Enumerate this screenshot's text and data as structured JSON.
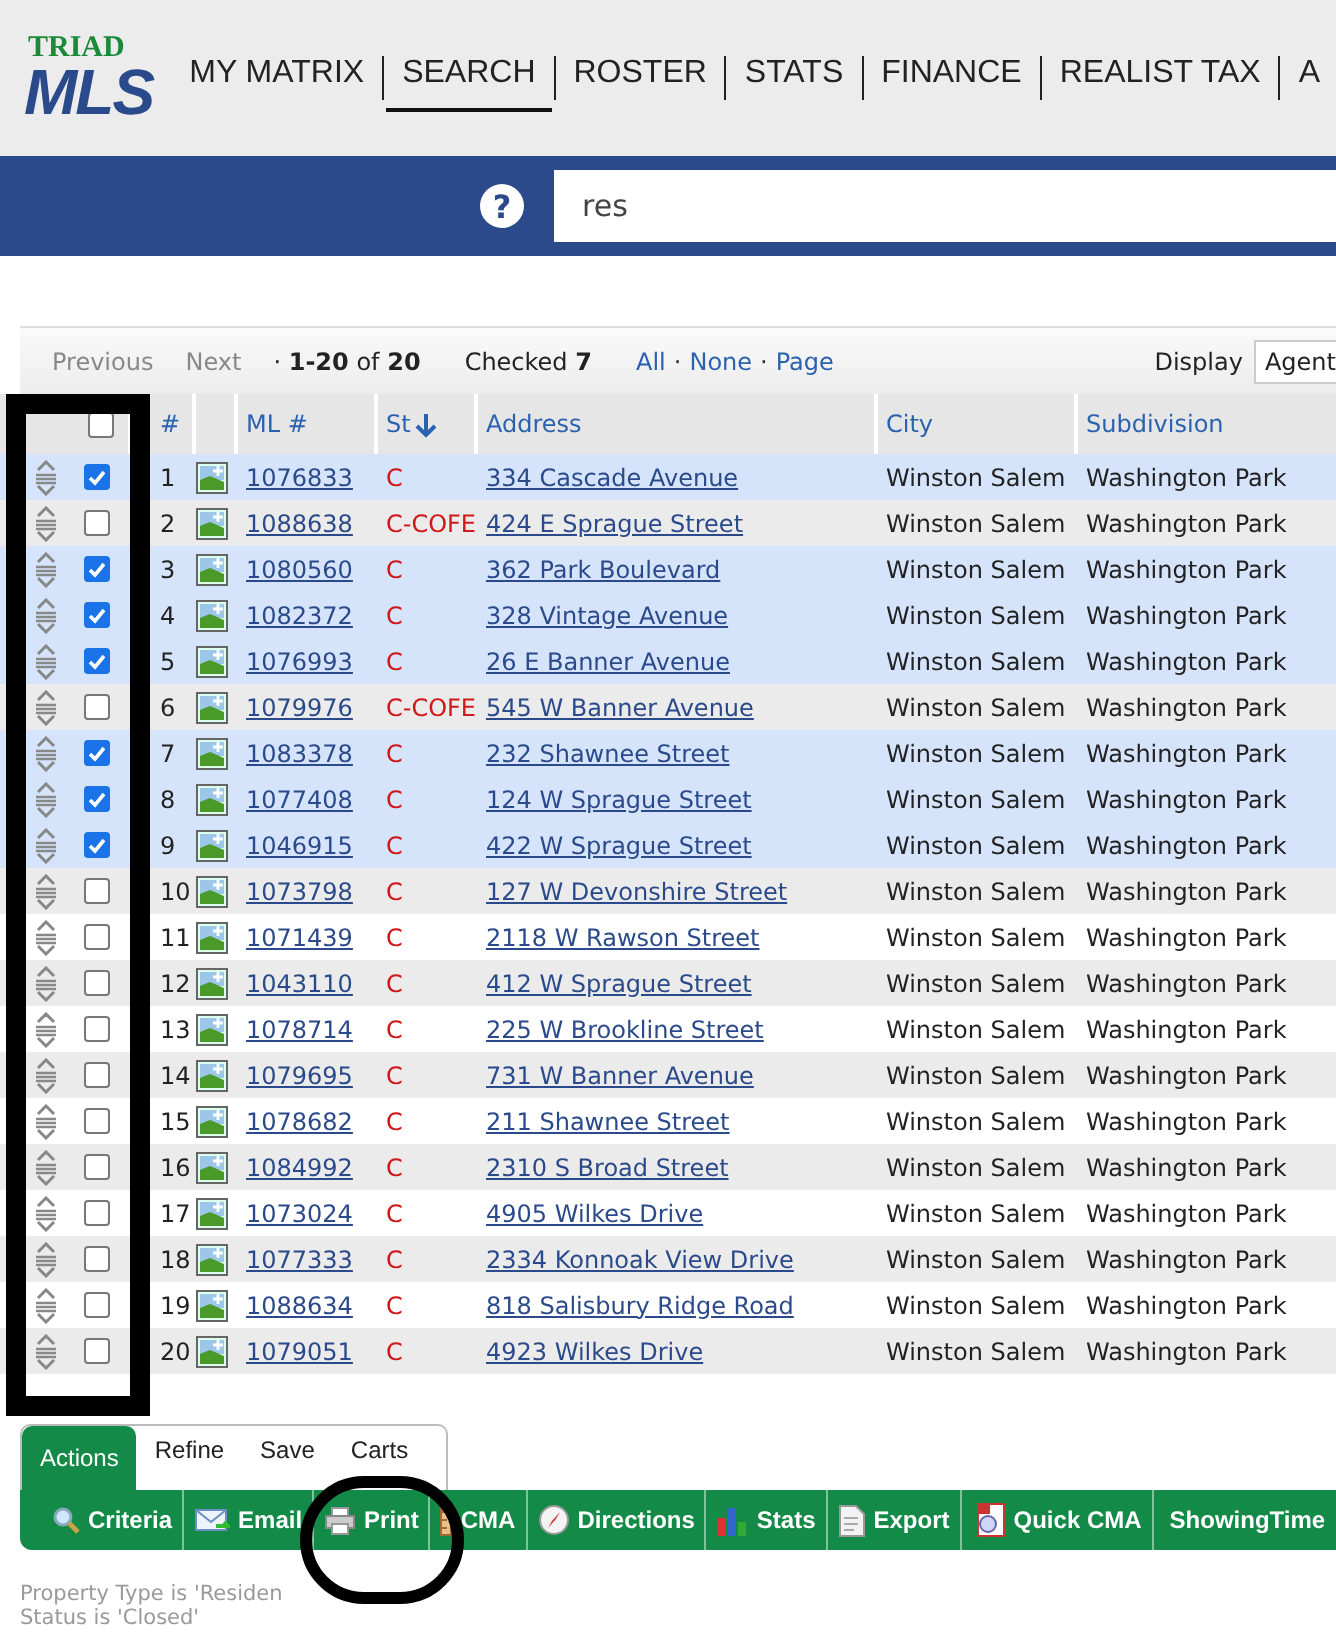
{
  "logo": {
    "top": "TRIAD",
    "main": "MLS"
  },
  "nav": [
    {
      "label": "MY MATRIX",
      "selected": false
    },
    {
      "label": "SEARCH",
      "selected": true
    },
    {
      "label": "ROSTER",
      "selected": false
    },
    {
      "label": "STATS",
      "selected": false
    },
    {
      "label": "FINANCE",
      "selected": false
    },
    {
      "label": "REALIST TAX",
      "selected": false
    },
    {
      "label": "A",
      "selected": false
    }
  ],
  "search": {
    "value": "res",
    "help": "?"
  },
  "pager": {
    "previous": "Previous",
    "next": "Next",
    "range_sep": "·",
    "range": "1-20",
    "of": "of",
    "total": "20",
    "checked_label": "Checked",
    "checked_count": "7",
    "links": [
      "All",
      "None",
      "Page"
    ],
    "display_label": "Display",
    "display_value": "Agent"
  },
  "table": {
    "all_checked": false,
    "columns": [
      "#",
      "ML #",
      "St",
      "Address",
      "City",
      "Subdivision"
    ],
    "rows": [
      {
        "num": "1",
        "mls": "1076833",
        "status": "C",
        "address": "334 Cascade Avenue",
        "city": "Winston Salem",
        "subdivision": "Washington Park",
        "checked": true
      },
      {
        "num": "2",
        "mls": "1088638",
        "status": "C-COFE",
        "address": "424 E Sprague Street",
        "city": "Winston Salem",
        "subdivision": "Washington Park",
        "checked": false
      },
      {
        "num": "3",
        "mls": "1080560",
        "status": "C",
        "address": "362 Park Boulevard",
        "city": "Winston Salem",
        "subdivision": "Washington Park",
        "checked": true
      },
      {
        "num": "4",
        "mls": "1082372",
        "status": "C",
        "address": "328 Vintage Avenue",
        "city": "Winston Salem",
        "subdivision": "Washington Park",
        "checked": true
      },
      {
        "num": "5",
        "mls": "1076993",
        "status": "C",
        "address": "26 E Banner Avenue",
        "city": "Winston Salem",
        "subdivision": "Washington Park",
        "checked": true
      },
      {
        "num": "6",
        "mls": "1079976",
        "status": "C-COFE",
        "address": "545 W Banner Avenue",
        "city": "Winston Salem",
        "subdivision": "Washington Park",
        "checked": false
      },
      {
        "num": "7",
        "mls": "1083378",
        "status": "C",
        "address": "232 Shawnee Street",
        "city": "Winston Salem",
        "subdivision": "Washington Park",
        "checked": true
      },
      {
        "num": "8",
        "mls": "1077408",
        "status": "C",
        "address": "124 W Sprague Street",
        "city": "Winston Salem",
        "subdivision": "Washington Park",
        "checked": true
      },
      {
        "num": "9",
        "mls": "1046915",
        "status": "C",
        "address": "422 W Sprague Street",
        "city": "Winston Salem",
        "subdivision": "Washington Park",
        "checked": true
      },
      {
        "num": "10",
        "mls": "1073798",
        "status": "C",
        "address": "127 W Devonshire Street",
        "city": "Winston Salem",
        "subdivision": "Washington Park",
        "checked": false
      },
      {
        "num": "11",
        "mls": "1071439",
        "status": "C",
        "address": "2118 W Rawson Street",
        "city": "Winston Salem",
        "subdivision": "Washington Park",
        "checked": false
      },
      {
        "num": "12",
        "mls": "1043110",
        "status": "C",
        "address": "412 W Sprague Street",
        "city": "Winston Salem",
        "subdivision": "Washington Park",
        "checked": false
      },
      {
        "num": "13",
        "mls": "1078714",
        "status": "C",
        "address": "225 W Brookline Street",
        "city": "Winston Salem",
        "subdivision": "Washington Park",
        "checked": false
      },
      {
        "num": "14",
        "mls": "1079695",
        "status": "C",
        "address": "731 W Banner Avenue",
        "city": "Winston Salem",
        "subdivision": "Washington Park",
        "checked": false
      },
      {
        "num": "15",
        "mls": "1078682",
        "status": "C",
        "address": "211 Shawnee Street",
        "city": "Winston Salem",
        "subdivision": "Washington Park",
        "checked": false
      },
      {
        "num": "16",
        "mls": "1084992",
        "status": "C",
        "address": "2310 S Broad Street",
        "city": "Winston Salem",
        "subdivision": "Washington Park",
        "checked": false
      },
      {
        "num": "17",
        "mls": "1073024",
        "status": "C",
        "address": "4905 Wilkes Drive",
        "city": "Winston Salem",
        "subdivision": "Washington Park",
        "checked": false
      },
      {
        "num": "18",
        "mls": "1077333",
        "status": "C",
        "address": "2334 Konnoak View Drive",
        "city": "Winston Salem",
        "subdivision": "Washington Park",
        "checked": false
      },
      {
        "num": "19",
        "mls": "1088634",
        "status": "C",
        "address": "818 Salisbury Ridge Road",
        "city": "Winston Salem",
        "subdivision": "Washington Park",
        "checked": false
      },
      {
        "num": "20",
        "mls": "1079051",
        "status": "C",
        "address": "4923 Wilkes Drive",
        "city": "Winston Salem",
        "subdivision": "Washington Park",
        "checked": false
      }
    ]
  },
  "tabs": [
    {
      "label": "Actions",
      "selected": true
    },
    {
      "label": "Refine",
      "selected": false
    },
    {
      "label": "Save",
      "selected": false
    },
    {
      "label": "Carts",
      "selected": false
    }
  ],
  "actions": [
    {
      "label": "Criteria",
      "kind": "search"
    },
    {
      "label": "Email",
      "kind": "email"
    },
    {
      "label": "Print",
      "kind": "print"
    },
    {
      "label": "CMA",
      "kind": "cma"
    },
    {
      "label": "Directions",
      "kind": "directions"
    },
    {
      "label": "Stats",
      "kind": "stats"
    },
    {
      "label": "Export",
      "kind": "export"
    },
    {
      "label": "Quick CMA",
      "kind": "quickcma"
    },
    {
      "label": "ShowingTime",
      "kind": "plain"
    }
  ],
  "criteria": [
    "Property Type is 'Residen",
    "Status is 'Closed'"
  ]
}
